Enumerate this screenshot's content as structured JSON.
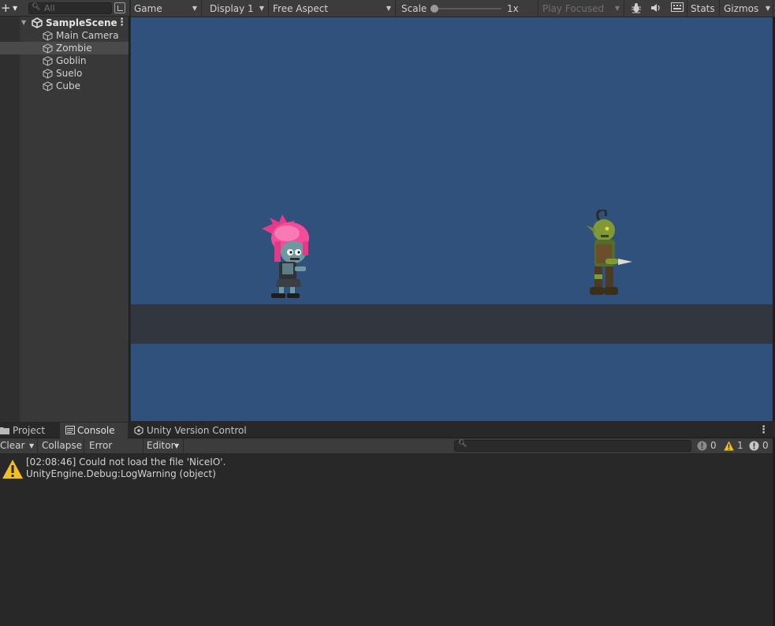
{
  "hierarchy": {
    "search_placeholder": "All",
    "scene_name": "SampleScene",
    "items": [
      {
        "label": "Main Camera",
        "selected": false
      },
      {
        "label": "Zombie",
        "selected": true
      },
      {
        "label": "Goblin",
        "selected": false
      },
      {
        "label": "Suelo",
        "selected": false
      },
      {
        "label": "Cube",
        "selected": false
      }
    ]
  },
  "game_toolbar": {
    "view": "Game",
    "display": "Display 1",
    "aspect": "Free Aspect",
    "scale_label": "Scale",
    "scale_value": "1x",
    "play_mode": "Play Focused",
    "stats_label": "Stats",
    "gizmos_label": "Gizmos"
  },
  "console": {
    "tabs": [
      {
        "label": "Project",
        "icon": "folder-icon",
        "active": false
      },
      {
        "label": "Console",
        "icon": "console-icon",
        "active": true
      },
      {
        "label": "Unity Version Control",
        "icon": "version-control-icon",
        "active": false
      }
    ],
    "toolbar": {
      "clear": "Clear",
      "collapse": "Collapse",
      "error_pause": "Error Pause",
      "editor": "Editor"
    },
    "counts": {
      "info": "0",
      "warning": "1",
      "error": "0"
    },
    "entries": [
      {
        "type": "warning",
        "line1": "[02:08:46] Could not load the file 'NiceIO'.",
        "line2": "UnityEngine.Debug:LogWarning (object)"
      }
    ]
  },
  "colors": {
    "viewport_bg": "#31517d",
    "ground": "#32363f",
    "panel_bg": "#383838",
    "warning": "#f0c020"
  }
}
